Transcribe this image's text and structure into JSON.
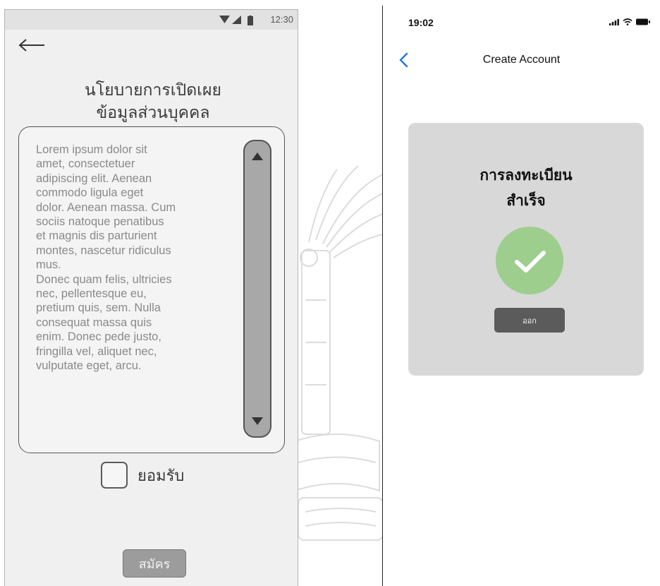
{
  "left_screen": {
    "status_time": "12:30",
    "title_line1": "นโยบายการเปิดเผย",
    "title_line2": "ข้อมูลส่วนบุคคล",
    "terms_text": "Lorem ipsum dolor sit\namet, consectetuer\nadipiscing elit. Aenean\ncommodo ligula eget\ndolor. Aenean massa. Cum\nsociis natoque penatibus\net magnis dis parturient\nmontes, nascetur ridiculus\nmus.\nDonec quam felis, ultricies\nnec, pellentesque eu,\npretium quis, sem. Nulla\nconsequat massa quis\nenim. Donec pede justo,\nfringilla vel, aliquet nec,\nvulputate eget, arcu.",
    "accept_label": "ยอมรับ",
    "register_label": "สมัคร"
  },
  "right_screen": {
    "status_time": "19:02",
    "title": "Create Account",
    "success_line1": "การลงทะเบียน",
    "success_line2": "สำเร็จ",
    "exit_label": "ออก",
    "accent_color": "#2b7bd8",
    "success_color": "#9dce8e"
  },
  "icons": {
    "left_status": [
      "wifi-icon",
      "signal-icon",
      "battery-icon"
    ],
    "left_back": "arrow-left-icon",
    "scroll": [
      "scroll-up-icon",
      "scroll-down-icon"
    ],
    "right_status": [
      "signal-icon",
      "wifi-icon",
      "battery-icon"
    ],
    "right_back": "chevron-left-icon",
    "success": "checkmark-icon"
  }
}
